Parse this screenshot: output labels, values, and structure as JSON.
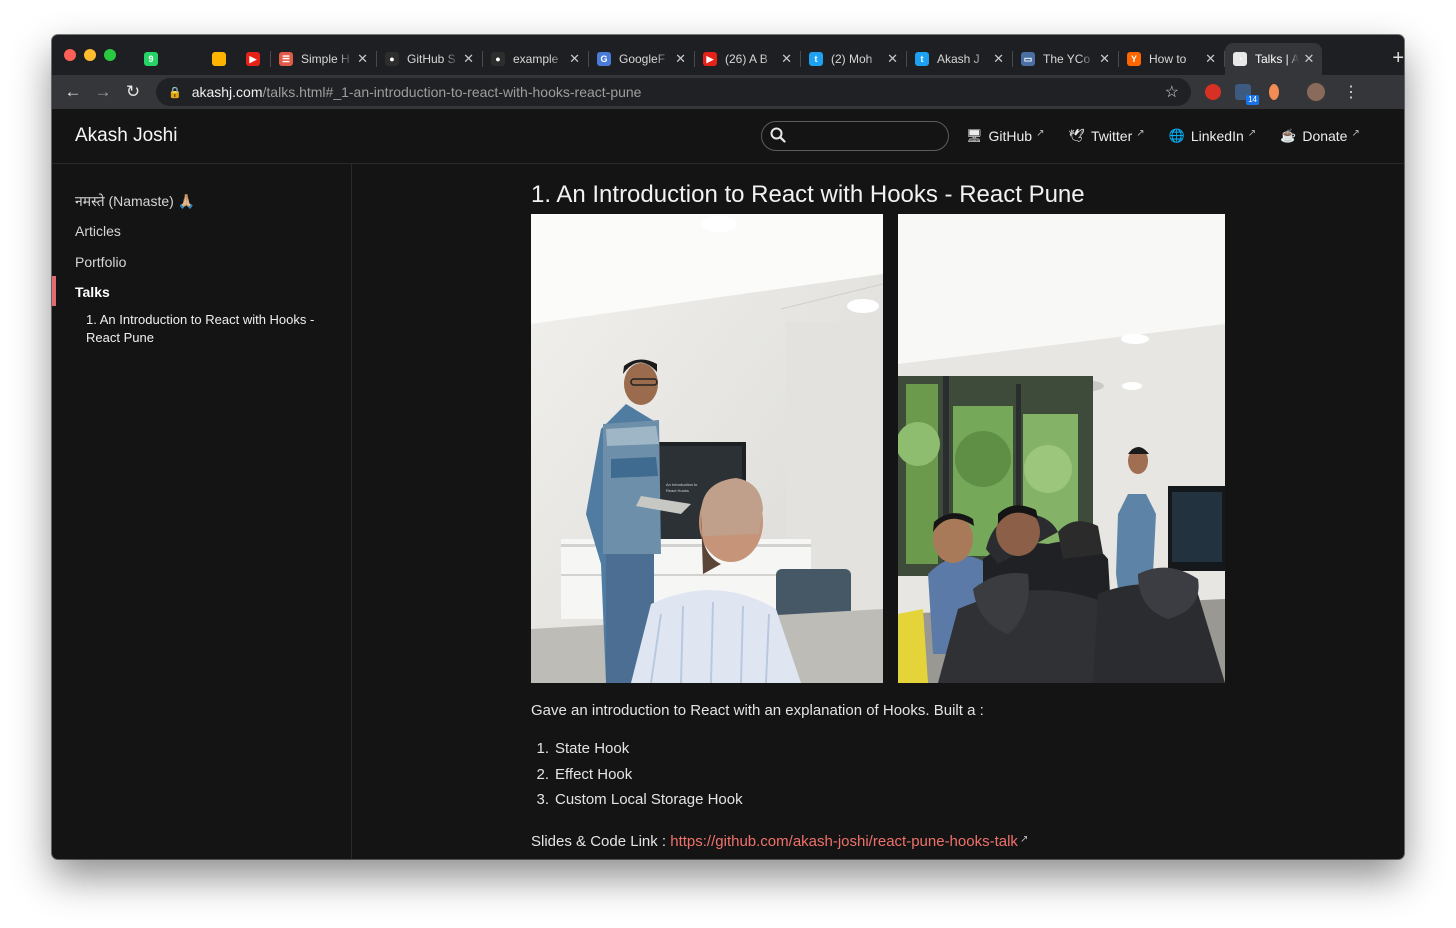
{
  "browser": {
    "tabs": [
      {
        "kind": "pinned",
        "icon": "whatsapp-icon",
        "color": "#25d366",
        "glyph": "9"
      },
      {
        "kind": "pinned",
        "icon": "blank-tab-icon",
        "color": "#1e1f22",
        "glyph": ""
      },
      {
        "kind": "pinned",
        "icon": "airtable-icon",
        "color": "#fcb400",
        "glyph": ""
      },
      {
        "kind": "pinned",
        "icon": "youtube-icon",
        "color": "#e62117",
        "glyph": "▶"
      },
      {
        "kind": "regular",
        "title": "Simple H",
        "icon": "list-icon",
        "color": "#e05a47",
        "glyph": "☰"
      },
      {
        "kind": "regular",
        "title": "GitHub S",
        "icon": "github-icon",
        "color": "#2d2d2d",
        "glyph": "●"
      },
      {
        "kind": "regular",
        "title": "example",
        "icon": "github-icon",
        "color": "#2d2d2d",
        "glyph": "●"
      },
      {
        "kind": "regular",
        "title": "GoogleF",
        "icon": "google-icon",
        "color": "#4a7bd8",
        "glyph": "G"
      },
      {
        "kind": "regular",
        "title": "(26) A B",
        "icon": "youtube-icon",
        "color": "#e62117",
        "glyph": "▶"
      },
      {
        "kind": "regular",
        "title": "(2) Moh",
        "icon": "twitter-icon",
        "color": "#1da1f2",
        "glyph": "t"
      },
      {
        "kind": "regular",
        "title": "Akash J",
        "icon": "twitter-icon",
        "color": "#1da1f2",
        "glyph": "t"
      },
      {
        "kind": "regular",
        "title": "The YCo",
        "icon": "ycombinator-icon",
        "color": "#4a6fa5",
        "glyph": "▭"
      },
      {
        "kind": "regular",
        "title": "How to",
        "icon": "hackernews-icon",
        "color": "#ff6600",
        "glyph": "Y"
      },
      {
        "kind": "active",
        "title": "Talks | A",
        "icon": "site-icon",
        "color": "#e8e8e8",
        "glyph": "◔"
      }
    ],
    "url_host": "akashj.com",
    "url_path": "/talks.html#_1-an-introduction-to-react-with-hooks-react-pune",
    "extension_badge": "14"
  },
  "site": {
    "title": "Akash Joshi",
    "search_placeholder": "",
    "nav": [
      {
        "label": "GitHub",
        "icon": "desktop-icon",
        "glyph": "🖥"
      },
      {
        "label": "Twitter",
        "icon": "bird-icon",
        "glyph": "🕊"
      },
      {
        "label": "LinkedIn",
        "icon": "globe-icon",
        "glyph": "🌐"
      },
      {
        "label": "Donate",
        "icon": "coffee-icon",
        "glyph": "☕"
      }
    ]
  },
  "sidebar": {
    "items": [
      {
        "label": "नमस्ते (Namaste) 🙏🏼"
      },
      {
        "label": "Articles"
      },
      {
        "label": "Portfolio"
      },
      {
        "label": "Talks"
      }
    ],
    "sub_item": "1. An Introduction to React with Hooks - React Pune",
    "accent_color": "#e26a73"
  },
  "article": {
    "title": "1. An Introduction to React with Hooks - React Pune",
    "description": "Gave an introduction to React with an explanation of Hooks. Built a :",
    "hooks": [
      {
        "num": "1.",
        "label": "State Hook"
      },
      {
        "num": "2.",
        "label": "Effect Hook"
      },
      {
        "num": "3.",
        "label": "Custom Local Storage Hook"
      }
    ],
    "slides_label": "Slides & Code Link : ",
    "slides_link": "https://github.com/akash-joshi/react-pune-hooks-talk",
    "link_color": "#f0716b",
    "slide_text_line1": "An Introduction to",
    "slide_text_line2": "React Hooks"
  }
}
